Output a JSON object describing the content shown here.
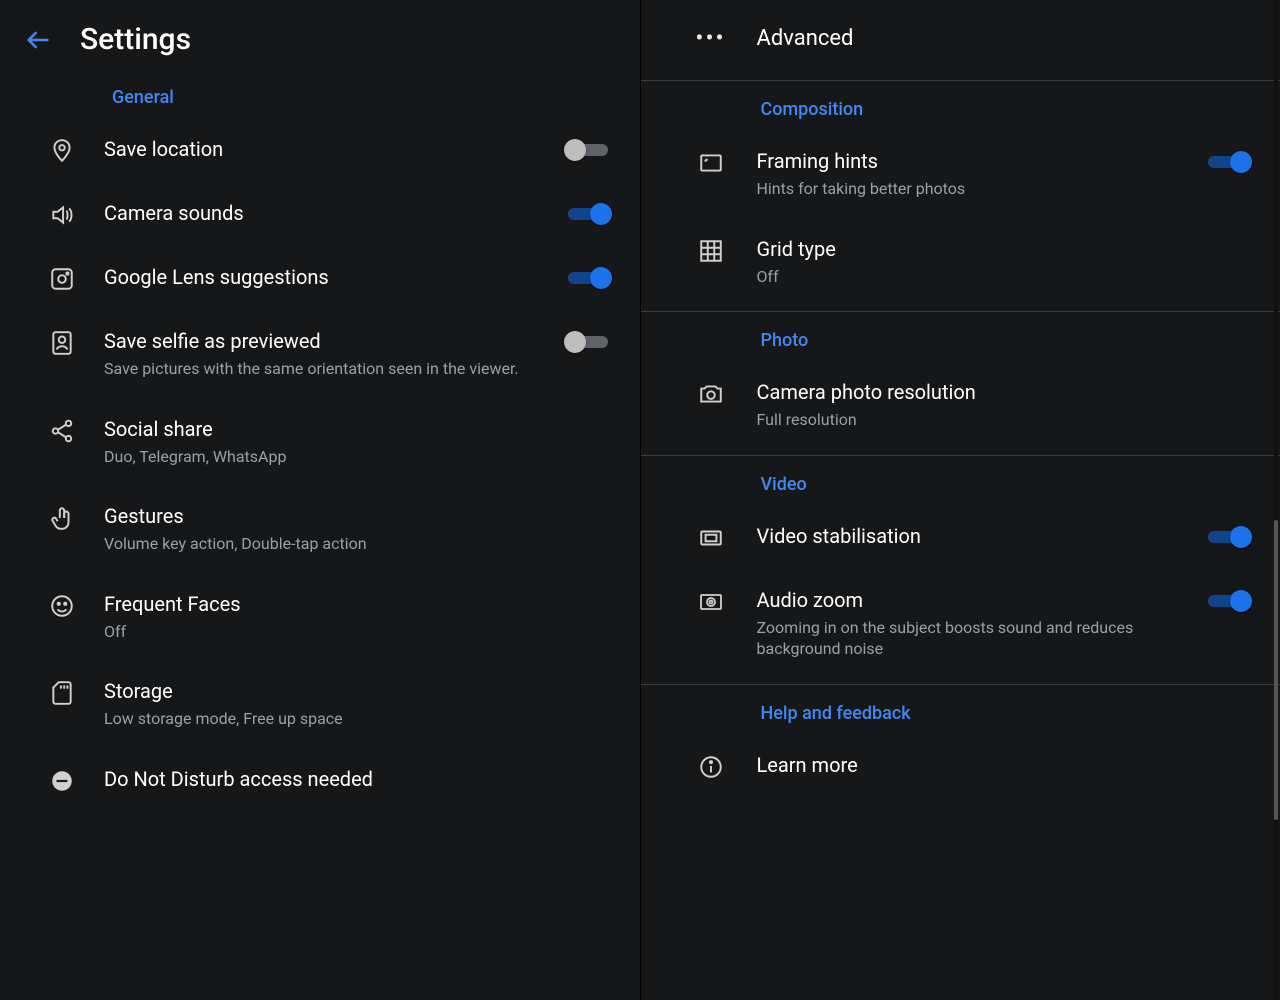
{
  "left": {
    "title": "Settings",
    "section_general": "General",
    "save_location": {
      "label": "Save location"
    },
    "camera_sounds": {
      "label": "Camera sounds"
    },
    "lens": {
      "label": "Google Lens suggestions"
    },
    "selfie": {
      "label": "Save selfie as previewed",
      "desc": "Save pictures with the same orientation seen in the viewer."
    },
    "social_share": {
      "label": "Social share",
      "desc": "Duo, Telegram, WhatsApp"
    },
    "gestures": {
      "label": "Gestures",
      "desc": "Volume key action, Double-tap action"
    },
    "frequent_faces": {
      "label": "Frequent Faces",
      "desc": "Off"
    },
    "storage": {
      "label": "Storage",
      "desc": "Low storage mode, Free up space"
    },
    "dnd": {
      "label": "Do Not Disturb access needed"
    }
  },
  "right": {
    "advanced": "Advanced",
    "section_composition": "Composition",
    "framing_hints": {
      "label": "Framing hints",
      "desc": "Hints for taking better photos"
    },
    "grid_type": {
      "label": "Grid type",
      "desc": "Off"
    },
    "section_photo": "Photo",
    "photo_resolution": {
      "label": "Camera photo resolution",
      "desc": "Full resolution"
    },
    "section_video": "Video",
    "video_stab": {
      "label": "Video stabilisation"
    },
    "audio_zoom": {
      "label": "Audio zoom",
      "desc": "Zooming in on the subject boosts sound and reduces background noise"
    },
    "section_help": "Help and feedback",
    "learn_more": {
      "label": "Learn more"
    }
  }
}
